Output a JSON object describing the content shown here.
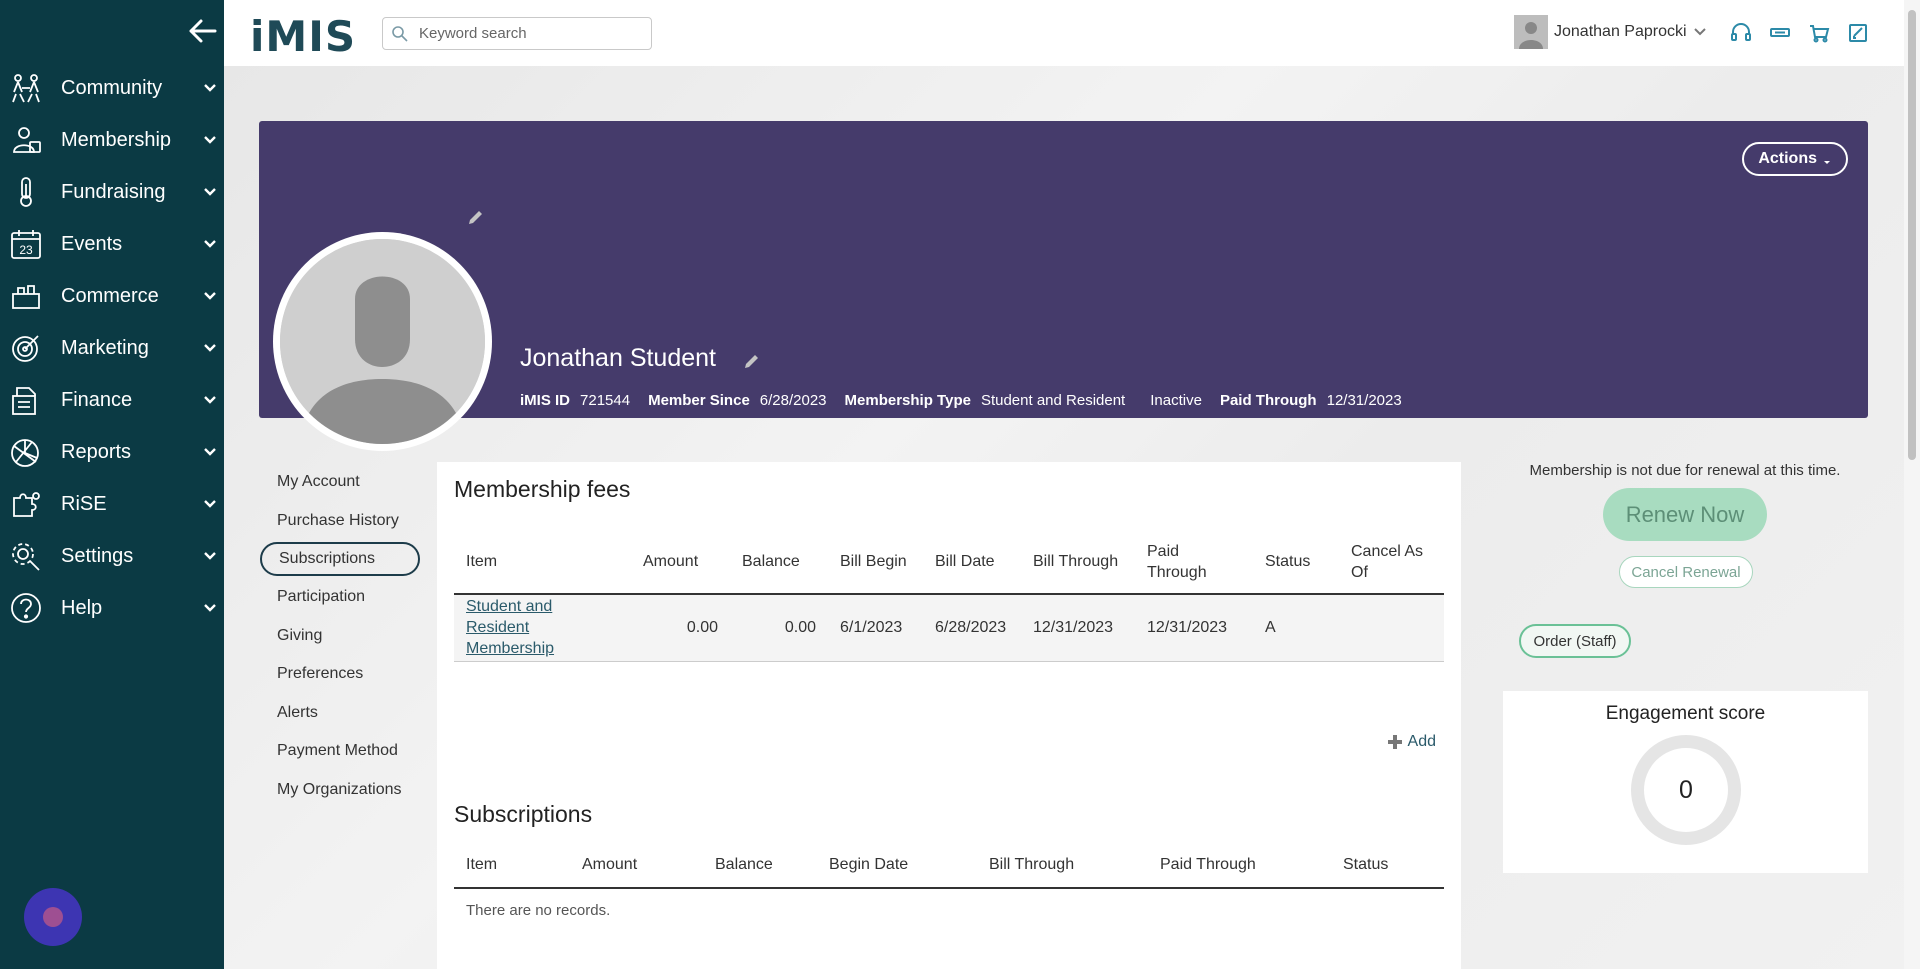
{
  "sidebar": {
    "back_icon": "arrow-left-icon",
    "items": [
      {
        "label": "Community",
        "icon": "community-icon"
      },
      {
        "label": "Membership",
        "icon": "membership-icon"
      },
      {
        "label": "Fundraising",
        "icon": "fundraising-icon"
      },
      {
        "label": "Events",
        "icon": "calendar-icon"
      },
      {
        "label": "Commerce",
        "icon": "commerce-icon"
      },
      {
        "label": "Marketing",
        "icon": "target-icon"
      },
      {
        "label": "Finance",
        "icon": "finance-icon"
      },
      {
        "label": "Reports",
        "icon": "pie-chart-icon"
      },
      {
        "label": "RiSE",
        "icon": "puzzle-icon"
      },
      {
        "label": "Settings",
        "icon": "gear-icon"
      },
      {
        "label": "Help",
        "icon": "help-icon"
      }
    ]
  },
  "topbar": {
    "logo": "iMIS",
    "search_placeholder": "Keyword search",
    "user_name": "Jonathan Paprocki"
  },
  "profile": {
    "actions_label": "Actions",
    "name": "Jonathan Student",
    "meta": {
      "imis_id_label": "iMIS ID",
      "imis_id": "721544",
      "member_since_label": "Member Since",
      "member_since": "6/28/2023",
      "membership_type_label": "Membership Type",
      "membership_type": "Student and Resident",
      "status": "Inactive",
      "paid_through_label": "Paid Through",
      "paid_through": "12/31/2023"
    }
  },
  "subnav": {
    "items": [
      "My Account",
      "Purchase History",
      "Subscriptions",
      "Participation",
      "Giving",
      "Preferences",
      "Alerts",
      "Payment Method",
      "My Organizations"
    ],
    "active": "Subscriptions"
  },
  "membership_fees": {
    "title": "Membership fees",
    "headers": [
      "Item",
      "Amount",
      "Balance",
      "Bill Begin",
      "Bill Date",
      "Bill Through",
      "Paid Through",
      "Status",
      "Cancel As Of"
    ],
    "rows": [
      {
        "item": "Student and Resident Membership",
        "amount": "0.00",
        "balance": "0.00",
        "bill_begin": "6/1/2023",
        "bill_date": "6/28/2023",
        "bill_through": "12/31/2023",
        "paid_through": "12/31/2023",
        "status": "A",
        "cancel_as_of": ""
      }
    ],
    "add_label": "Add"
  },
  "subscriptions": {
    "title": "Subscriptions",
    "headers": [
      "Item",
      "Amount",
      "Balance",
      "Begin Date",
      "Bill Through",
      "Paid Through",
      "Status"
    ],
    "empty_text": "There are no records."
  },
  "renewal": {
    "message": "Membership is not due for renewal at this time.",
    "renew_label": "Renew Now",
    "cancel_label": "Cancel Renewal",
    "order_label": "Order (Staff)"
  },
  "engagement": {
    "title": "Engagement score",
    "score": "0"
  }
}
